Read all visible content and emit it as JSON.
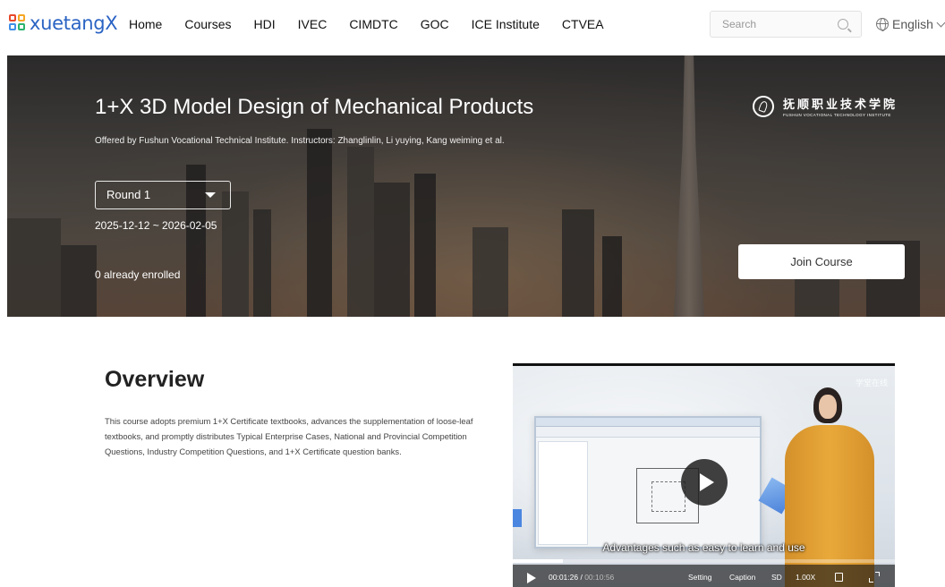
{
  "header": {
    "logo_text": "xuetangX",
    "nav": [
      "Home",
      "Courses",
      "HDI",
      "IVEC",
      "CIMDTC",
      "GOC",
      "ICE Institute",
      "CTVEA"
    ],
    "search_placeholder": "Search",
    "language": "English"
  },
  "hero": {
    "title": "1+X 3D Model Design of Mechanical Products",
    "offered_by": "Offered by Fushun Vocational Technical Institute. Instructors: Zhanglinlin, Li yuying, Kang weiming et al.",
    "round": "Round 1",
    "date_range": "2025-12-12 ~ 2026-02-05",
    "enrolled": "0 already enrolled",
    "join_label": "Join Course",
    "institute_cn": "抚顺职业技术学院",
    "institute_en": "FUSHUN VOCATIONAL TECHNOLOGY INSTITUTE"
  },
  "overview": {
    "title": "Overview",
    "text": "This course adopts premium 1+X Certificate textbooks, advances the supplementation of loose-leaf textbooks, and promptly distributes Typical Enterprise Cases, National and Provincial Competition Questions, Industry Competition Questions, and 1+X Certificate question banks."
  },
  "video": {
    "watermark": "学堂在线",
    "subtitle": "Advantages such as easy to learn and use",
    "current_time": "00:01:26",
    "total_time": "00:10:56",
    "progress": 0.131,
    "setting_label": "Setting",
    "caption_label": "Caption",
    "quality_label": "SD",
    "speed_label": "1.00X"
  },
  "colors": {
    "brand_blue": "#2a63c4"
  }
}
